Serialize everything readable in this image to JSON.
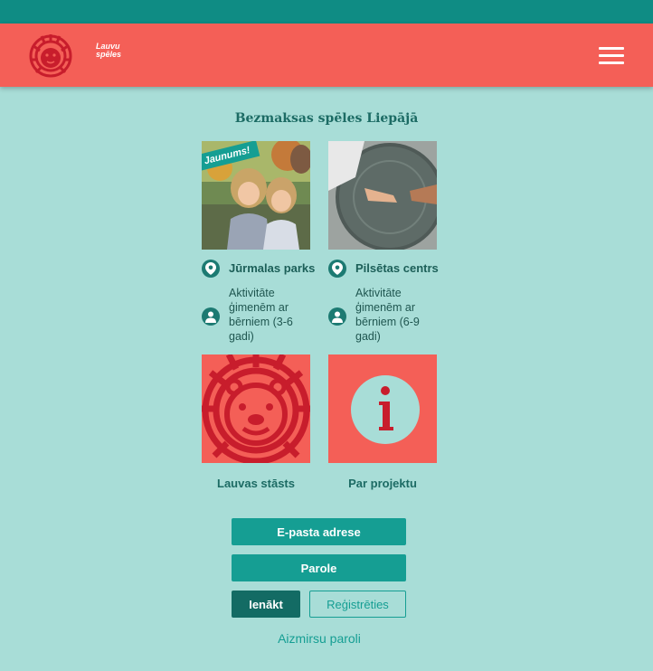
{
  "header": {
    "logo_line1": "Lauvu",
    "logo_line2": "spēles"
  },
  "page_title": "Bezmaksas spēles Liepājā",
  "cards": [
    {
      "badge": "Jaunums!",
      "location": "Jūrmalas parks",
      "audience": "Aktivitāte ģimenēm ar bērniem (3-6 gadi)"
    },
    {
      "location": "Pilsētas centrs",
      "audience": "Aktivitāte ģimenēm ar bērniem (6-9 gadi)"
    }
  ],
  "tiles": [
    {
      "label": "Lauvas stāsts"
    },
    {
      "label": "Par projektu"
    }
  ],
  "form": {
    "email_label": "E-pasta adrese",
    "password_label": "Parole",
    "login_label": "Ienākt",
    "register_label": "Reģistrēties",
    "forgot_label": "Aizmirsu paroli"
  },
  "colors": {
    "top_strip": "#0f8c84",
    "header": "#f45f57",
    "background": "#a8ddd7",
    "accent": "#159e93",
    "dark_teal": "#136b64"
  }
}
